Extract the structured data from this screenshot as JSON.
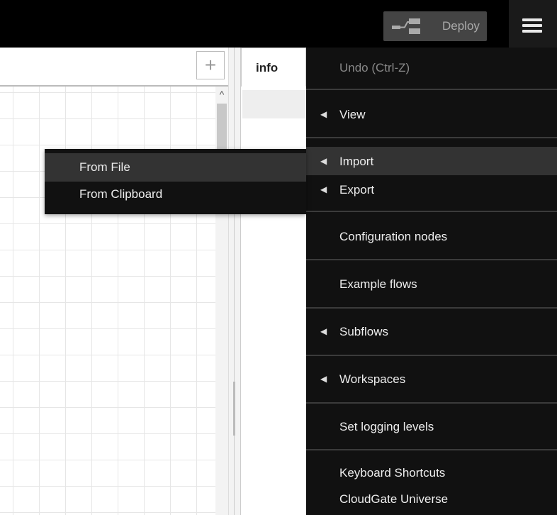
{
  "header": {
    "deploy_label": "Deploy",
    "menu_icon": "hamburger-menu-icon"
  },
  "workspace": {
    "add_tab_symbol": "+",
    "scroll_up_symbol": "^"
  },
  "sidebar": {
    "tab_label": "info"
  },
  "main_menu": {
    "items": [
      {
        "label": "Undo (Ctrl-Z)",
        "submenu": false,
        "disabled": true
      },
      {
        "label": "View",
        "submenu": true
      },
      {
        "label": "Import",
        "submenu": true,
        "active": true
      },
      {
        "label": "Export",
        "submenu": true
      },
      {
        "label": "Configuration nodes",
        "submenu": false
      },
      {
        "label": "Example flows",
        "submenu": false
      },
      {
        "label": "Subflows",
        "submenu": true
      },
      {
        "label": "Workspaces",
        "submenu": true
      },
      {
        "label": "Set logging levels",
        "submenu": false
      },
      {
        "label": "Keyboard Shortcuts",
        "submenu": false
      },
      {
        "label": "CloudGate Universe",
        "submenu": false
      }
    ],
    "arrow_glyph": "◀"
  },
  "import_submenu": {
    "items": [
      {
        "label": "From File",
        "active": true
      },
      {
        "label": "From Clipboard"
      }
    ]
  },
  "colors": {
    "header_bg": "#000000",
    "menu_bg": "#111111",
    "menu_active_bg": "#333333",
    "deploy_bg": "#444444"
  }
}
